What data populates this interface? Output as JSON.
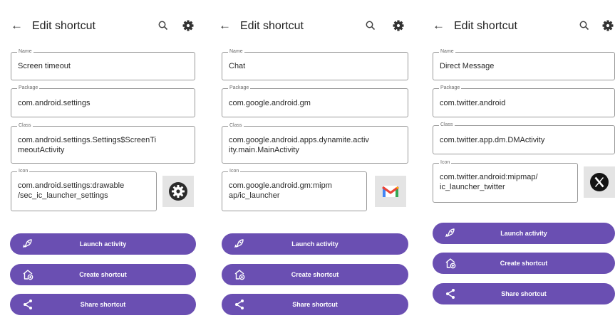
{
  "colors": {
    "button_bg": "#6a4fb2",
    "border": "#9a9a9a",
    "icon_bg": "#e4e4e4"
  },
  "icons": {
    "back": "back-arrow-icon",
    "search": "search-icon",
    "settings": "gear-icon",
    "launch": "rocket-icon",
    "create": "add-shortcut-icon",
    "share": "share-icon"
  },
  "screens": [
    {
      "header": {
        "back": "←",
        "title": "Edit shortcut"
      },
      "name": {
        "label": "Name",
        "value": "Screen timeout"
      },
      "package": {
        "label": "Package",
        "value": "com.android.settings"
      },
      "class": {
        "label": "Class",
        "value": "com.android.settings.Settings$ScreenTi meoutActivity"
      },
      "icon": {
        "label": "Icon",
        "value": "com.android.settings:drawable /sec_ic_launcher_settings",
        "preview": "settings-app-icon"
      },
      "buttons": {
        "launch": "Launch activity",
        "create": "Create shortcut",
        "share": "Share shortcut"
      }
    },
    {
      "header": {
        "back": "←",
        "title": "Edit shortcut"
      },
      "name": {
        "label": "Name",
        "value": "Chat"
      },
      "package": {
        "label": "Package",
        "value": "com.google.android.gm"
      },
      "class": {
        "label": "Class",
        "value": "com.google.android.apps.dynamite.activ ity.main.MainActivity"
      },
      "icon": {
        "label": "Icon",
        "value": "com.google.android.gm:mipm ap/ic_launcher",
        "preview": "gmail-app-icon"
      },
      "buttons": {
        "launch": "Launch activity",
        "create": "Create shortcut",
        "share": "Share shortcut"
      }
    },
    {
      "header": {
        "back": "←",
        "title": "Edit shortcut"
      },
      "name": {
        "label": "Name",
        "value": "Direct Message"
      },
      "package": {
        "label": "Package",
        "value": "com.twitter.android"
      },
      "class": {
        "label": "Class",
        "value": "com.twitter.app.dm.DMActivity"
      },
      "icon": {
        "label": "Icon",
        "value": "com.twitter.android:mipmap/ ic_launcher_twitter",
        "preview": "x-app-icon"
      },
      "buttons": {
        "launch": "Launch activity",
        "create": "Create shortcut",
        "share": "Share shortcut"
      }
    }
  ]
}
